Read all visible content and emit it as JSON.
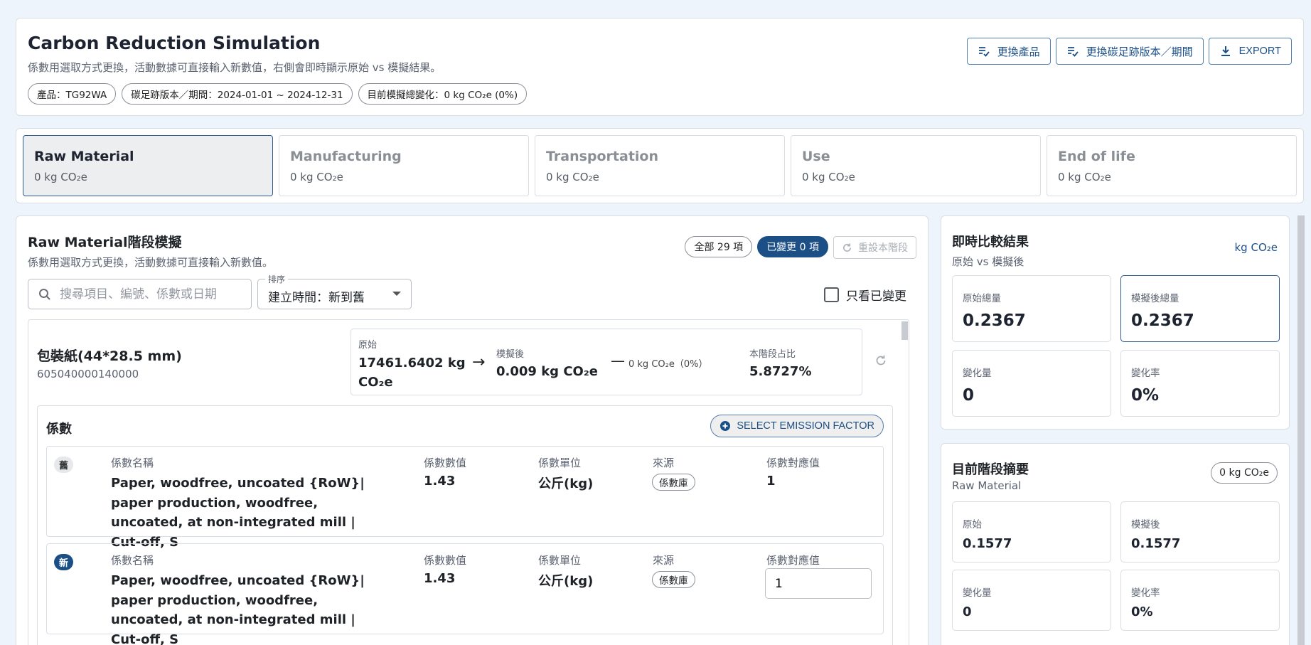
{
  "header": {
    "title": "Carbon Reduction Simulation",
    "subtitle": "係數用選取方式更換，活動數據可直接輸入新數值，右側會即時顯示原始 vs 模擬結果。",
    "chips": [
      "產品：TG92WA",
      "碳足跡版本／期間：2024-01-01 ~ 2024-12-31",
      "目前模擬總變化：0 kg CO₂e (0%)"
    ],
    "actions": {
      "change_product": "更換產品",
      "change_version": "更換碳足跡版本／期間",
      "export": "EXPORT"
    }
  },
  "stages": [
    {
      "name": "Raw Material",
      "value": "0 kg CO₂e",
      "active": true
    },
    {
      "name": "Manufacturing",
      "value": "0 kg CO₂e",
      "active": false
    },
    {
      "name": "Transportation",
      "value": "0 kg CO₂e",
      "active": false
    },
    {
      "name": "Use",
      "value": "0 kg CO₂e",
      "active": false
    },
    {
      "name": "End of life",
      "value": "0 kg CO₂e",
      "active": false
    }
  ],
  "sim": {
    "title": "Raw Material階段模擬",
    "subtitle": "係數用選取方式更換，活動數據可直接輸入新數值。",
    "all_count": "全部 29 項",
    "changed_count": "已變更 0 項",
    "reset_stage": "重設本階段",
    "search_placeholder": "搜尋項目、編號、係數或日期",
    "sort_label": "排序",
    "sort_value": "建立時間：新到舊",
    "only_changed": "只看已變更",
    "item": {
      "name": "包裝紙(44*28.5 mm)",
      "code": "605040000140000",
      "original_label": "原始",
      "original_value_1": "17461.6402 kg",
      "original_value_2": "CO₂e",
      "simulated_label": "模擬後",
      "simulated_value": "0.009 kg CO₂e",
      "delta": "0 kg CO₂e（0%）",
      "share_label": "本階段占比",
      "share_value": "5.8727%"
    },
    "coef": {
      "title": "係數",
      "select_button": "SELECT EMISSION FACTOR",
      "labels": {
        "name": "係數名稱",
        "value": "係數數值",
        "unit": "係數單位",
        "source": "來源",
        "mapping": "係數對應值"
      },
      "old": {
        "tag": "舊",
        "name": "Paper, woodfree, uncoated {RoW}| paper production, woodfree, uncoated, at non-integrated mill | Cut-off, S",
        "value": "1.43",
        "unit": "公斤(kg)",
        "source": "係數庫",
        "mapping": "1"
      },
      "new": {
        "tag": "新",
        "name": "Paper, woodfree, uncoated {RoW}| paper production, woodfree, uncoated, at non-integrated mill | Cut-off, S",
        "value": "1.43",
        "unit": "公斤(kg)",
        "source": "係數庫",
        "mapping": "1"
      }
    }
  },
  "compare": {
    "title": "即時比較結果",
    "subtitle": "原始 vs 模擬後",
    "unit": "kg CO₂e",
    "cards": [
      {
        "label": "原始總量",
        "value": "0.2367"
      },
      {
        "label": "模擬後總量",
        "value": "0.2367"
      },
      {
        "label": "變化量",
        "value": "0"
      },
      {
        "label": "變化率",
        "value": "0%"
      }
    ]
  },
  "summary": {
    "title": "目前階段摘要",
    "subtitle": "Raw Material",
    "unit": "0 kg CO₂e",
    "cards": [
      {
        "label": "原始",
        "value": "0.1577"
      },
      {
        "label": "模擬後",
        "value": "0.1577"
      },
      {
        "label": "變化量",
        "value": "0"
      },
      {
        "label": "變化率",
        "value": "0%"
      }
    ]
  },
  "colors": {
    "accent": "#1c4f86",
    "border": "#d9dee5",
    "background": "#eef4fb"
  }
}
